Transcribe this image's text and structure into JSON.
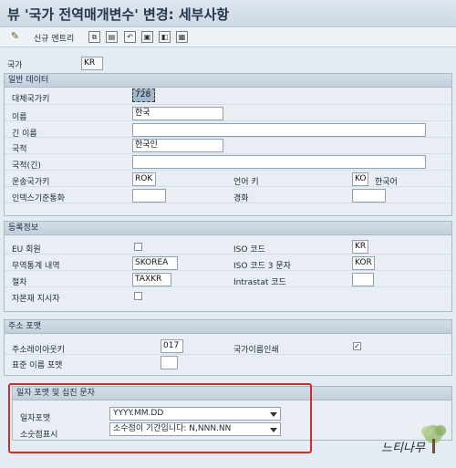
{
  "window": {
    "title": "뷰 '국가 전역매개변수' 변경: 세부사항"
  },
  "toolbar": {
    "new_entries_label": "신규 엔트리"
  },
  "country": {
    "label": "국가",
    "value": "KR"
  },
  "general": {
    "header": "일반 데이터",
    "alt_key_label": "대체국가키",
    "alt_key_value": "728",
    "name_label": "이름",
    "name_value": "한국",
    "long_name_label": "긴 이름",
    "long_name_value": "",
    "nationality_label": "국적",
    "nationality_value": "한국인",
    "nationality_long_label": "국적(긴)",
    "nationality_long_value": "",
    "vehicle_key_label": "운송국가키",
    "vehicle_key_value": "ROK",
    "language_key_label": "언어 키",
    "language_key_value": "KO",
    "language_text": "한국어",
    "index_currency_label": "인덱스기준통화",
    "index_currency_value": "",
    "hard_currency_label": "경화",
    "hard_currency_value": ""
  },
  "registration": {
    "header": "등록정보",
    "eu_label": "EU 회원",
    "eu_checked": false,
    "iso_label": "ISO 코드",
    "iso_value": "KR",
    "trade_stat_label": "무역통계 내역",
    "trade_stat_value": "SKOREA",
    "iso3_label": "ISO 코드 3 문자",
    "iso3_value": "KOR",
    "procedure_label": "절차",
    "procedure_value": "TAXKR",
    "intrastat_label": "Intrastat 코드",
    "intrastat_value": "",
    "capital_goods_label": "자본재 지시자",
    "capital_goods_checked": false
  },
  "address": {
    "header": "주소 포맷",
    "layout_key_label": "주소레이아웃키",
    "layout_key_value": "017",
    "print_country_label": "국가이름인쇄",
    "print_country_checked": true,
    "std_name_label": "표준 이름 포맷",
    "std_name_value": ""
  },
  "date_format": {
    "header": "일자 포맷 및 십진 문자",
    "date_label": "일자포맷",
    "date_value": "YYYY.MM.DD",
    "decimal_label": "소숫점표시",
    "decimal_value": "소수점이 기간입니다: N,NNN.NN"
  },
  "watermark": {
    "text": "느티나무"
  },
  "colors": {
    "highlight": "#d42a2a",
    "accent": "#21364d"
  }
}
